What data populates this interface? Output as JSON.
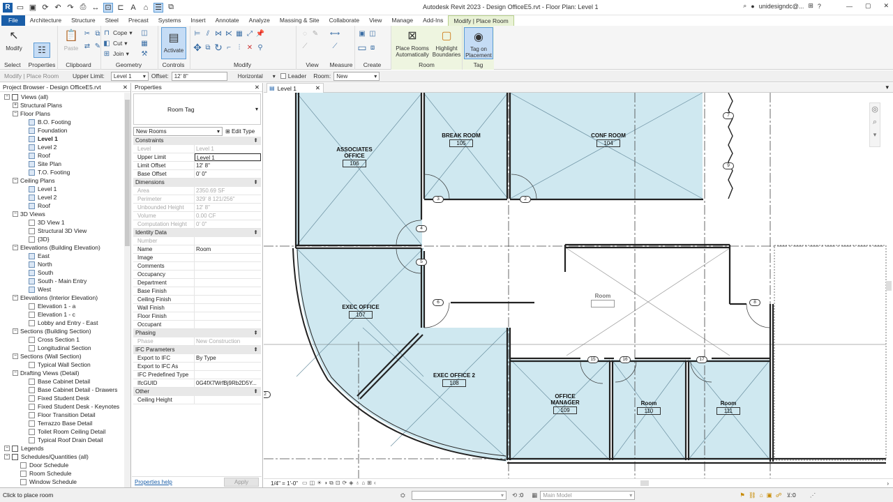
{
  "titlebar": {
    "title": "Autodesk Revit 2023 - Design OfficeE5.rvt - Floor Plan: Level 1",
    "user": "unidesigndc@...",
    "icons": [
      "binoculars-icon",
      "user-icon",
      "cart-icon",
      "help-icon"
    ]
  },
  "tabs": [
    "File",
    "Architecture",
    "Structure",
    "Steel",
    "Precast",
    "Systems",
    "Insert",
    "Annotate",
    "Analyze",
    "Massing & Site",
    "Collaborate",
    "View",
    "Manage",
    "Add-Ins",
    "Modify | Place Room"
  ],
  "ribbon": {
    "modify": "Modify",
    "select": "Select",
    "properties": "Properties",
    "paste": "Paste",
    "clipboard": "Clipboard",
    "cope": "Cope",
    "cut": "Cut",
    "join": "Join",
    "geometry": "Geometry",
    "activate": "Activate",
    "controls": "Controls",
    "modify_panel": "Modify",
    "view": "View",
    "measure": "Measure",
    "create": "Create",
    "place_rooms": "Place Rooms Automatically",
    "highlight": "Highlight Boundaries",
    "room_panel": "Room",
    "tag_on": "Tag on Placement",
    "tag_panel": "Tag"
  },
  "options": {
    "context": "Modify | Place Room",
    "upper_limit_label": "Upper Limit:",
    "upper_limit": "Level 1",
    "offset_label": "Offset:",
    "offset": "12'  8\"",
    "orientation": "Horizontal",
    "leader": "Leader",
    "room_label": "Room:",
    "room": "New"
  },
  "browser": {
    "title": "Project Browser - Design OfficeE5.rvt",
    "items": [
      {
        "t": "Views (all)",
        "d": 0,
        "e": "-",
        "i": "folder"
      },
      {
        "t": "Structural Plans",
        "d": 1,
        "e": "+"
      },
      {
        "t": "Floor Plans",
        "d": 1,
        "e": "-"
      },
      {
        "t": "B.O. Footing",
        "d": 2,
        "i": "v"
      },
      {
        "t": "Foundation",
        "d": 2,
        "i": "v"
      },
      {
        "t": "Level 1",
        "d": 2,
        "i": "v",
        "b": true
      },
      {
        "t": "Level 2",
        "d": 2,
        "i": "v"
      },
      {
        "t": "Roof",
        "d": 2,
        "i": "v"
      },
      {
        "t": "Site Plan",
        "d": 2,
        "i": "v"
      },
      {
        "t": "T.O. Footing",
        "d": 2,
        "i": "v"
      },
      {
        "t": "Ceiling Plans",
        "d": 1,
        "e": "-"
      },
      {
        "t": "Level 1",
        "d": 2,
        "i": "v"
      },
      {
        "t": "Level 2",
        "d": 2,
        "i": "v"
      },
      {
        "t": "Roof",
        "d": 2,
        "i": "v"
      },
      {
        "t": "3D Views",
        "d": 1,
        "e": "-"
      },
      {
        "t": "3D View 1",
        "d": 2,
        "i": "w"
      },
      {
        "t": "Structural 3D View",
        "d": 2,
        "i": "w"
      },
      {
        "t": "{3D}",
        "d": 2,
        "i": "w"
      },
      {
        "t": "Elevations (Building Elevation)",
        "d": 1,
        "e": "-"
      },
      {
        "t": "East",
        "d": 2,
        "i": "v"
      },
      {
        "t": "North",
        "d": 2,
        "i": "v"
      },
      {
        "t": "South",
        "d": 2,
        "i": "v"
      },
      {
        "t": "South - Main Entry",
        "d": 2,
        "i": "v"
      },
      {
        "t": "West",
        "d": 2,
        "i": "v"
      },
      {
        "t": "Elevations (Interior Elevation)",
        "d": 1,
        "e": "-"
      },
      {
        "t": "Elevation 1 - a",
        "d": 2,
        "i": "w"
      },
      {
        "t": "Elevation 1 - c",
        "d": 2,
        "i": "w"
      },
      {
        "t": "Lobby and Entry - East",
        "d": 2,
        "i": "w"
      },
      {
        "t": "Sections (Building Section)",
        "d": 1,
        "e": "-"
      },
      {
        "t": "Cross Section 1",
        "d": 2,
        "i": "w"
      },
      {
        "t": "Longitudinal Section",
        "d": 2,
        "i": "w"
      },
      {
        "t": "Sections (Wall Section)",
        "d": 1,
        "e": "-"
      },
      {
        "t": "Typical Wall Section",
        "d": 2,
        "i": "w"
      },
      {
        "t": "Drafting Views (Detail)",
        "d": 1,
        "e": "-"
      },
      {
        "t": "Base Cabinet Detail",
        "d": 2,
        "i": "w"
      },
      {
        "t": "Base Cabinet Detail - Drawers",
        "d": 2,
        "i": "w"
      },
      {
        "t": "Fixed Student Desk",
        "d": 2,
        "i": "w"
      },
      {
        "t": "Fixed Student Desk - Keynotes",
        "d": 2,
        "i": "w"
      },
      {
        "t": "Floor Transition Detail",
        "d": 2,
        "i": "w"
      },
      {
        "t": "Terrazzo Base Detail",
        "d": 2,
        "i": "w"
      },
      {
        "t": "Toilet Room Ceiling Detail",
        "d": 2,
        "i": "w"
      },
      {
        "t": "Typical Roof Drain Detail",
        "d": 2,
        "i": "w"
      },
      {
        "t": "Legends",
        "d": 0,
        "e": "-",
        "i": "folder"
      },
      {
        "t": "Schedules/Quantities (all)",
        "d": 0,
        "e": "-",
        "i": "folder"
      },
      {
        "t": "Door Schedule",
        "d": 1,
        "i": "s"
      },
      {
        "t": "Room Schedule",
        "d": 1,
        "i": "s"
      },
      {
        "t": "Window Schedule",
        "d": 1,
        "i": "s"
      }
    ]
  },
  "props": {
    "title": "Properties",
    "type_name": "Room Tag",
    "filter": "New Rooms",
    "edit_type": "Edit Type",
    "help": "Properties help",
    "apply": "Apply",
    "groups": [
      {
        "name": "Constraints",
        "rows": [
          [
            "Level",
            "Level 1",
            1
          ],
          [
            "Upper Limit",
            "Level 1",
            0
          ],
          [
            "Limit Offset",
            "12'  8\"",
            0
          ],
          [
            "Base Offset",
            "0'  0\"",
            0
          ]
        ]
      },
      {
        "name": "Dimensions",
        "rows": [
          [
            "Area",
            "2350.69 SF",
            1
          ],
          [
            "Perimeter",
            "329'  8 121/256\"",
            1
          ],
          [
            "Unbounded Height",
            "12'  8\"",
            1
          ],
          [
            "Volume",
            "0.00 CF",
            1
          ],
          [
            "Computation Height",
            "0'  0\"",
            1
          ]
        ]
      },
      {
        "name": "Identity Data",
        "rows": [
          [
            "Number",
            "",
            1
          ],
          [
            "Name",
            "Room",
            0
          ],
          [
            "Image",
            "",
            0
          ],
          [
            "Comments",
            "",
            0
          ],
          [
            "Occupancy",
            "",
            0
          ],
          [
            "Department",
            "",
            0
          ],
          [
            "Base Finish",
            "",
            0
          ],
          [
            "Ceiling Finish",
            "",
            0
          ],
          [
            "Wall Finish",
            "",
            0
          ],
          [
            "Floor Finish",
            "",
            0
          ],
          [
            "Occupant",
            "",
            0
          ]
        ]
      },
      {
        "name": "Phasing",
        "rows": [
          [
            "Phase",
            "New Construction",
            1
          ]
        ]
      },
      {
        "name": "IFC Parameters",
        "rows": [
          [
            "Export to IFC",
            "By Type",
            0
          ],
          [
            "Export to IFC As",
            "",
            0
          ],
          [
            "IFC Predefined Type",
            "",
            0
          ],
          [
            "IfcGUID",
            "0G4fX7WrfBj9Rb2D5Y...",
            0
          ]
        ]
      },
      {
        "name": "Other",
        "rows": [
          [
            "Ceiling Height",
            "",
            0
          ]
        ]
      }
    ]
  },
  "view": {
    "tab": "Level 1",
    "scale": "1/4\" = 1'-0\"",
    "rooms": [
      {
        "name": "ASSOCIATES",
        "name2": "OFFICE",
        "num": "106"
      },
      {
        "name": "BREAK ROOM",
        "num": "105"
      },
      {
        "name": "CONF ROOM",
        "num": "104"
      },
      {
        "name": "EXEC OFFICE",
        "num": "107"
      },
      {
        "name": "EXEC OFFICE 2",
        "num": "108"
      },
      {
        "name": "OFFICE",
        "name2": "MANAGER",
        "num": "109"
      },
      {
        "name": "Room",
        "num": "110"
      },
      {
        "name": "Room",
        "num": "111"
      },
      {
        "name": "Room",
        "num": ""
      }
    ],
    "door_tags": [
      "3",
      "2",
      "4",
      "5",
      "6",
      "8",
      "7",
      "9",
      "15",
      "16",
      "17",
      "2"
    ]
  },
  "status": {
    "text": "Click to place room",
    "coords": ":0",
    "model": "Main Model",
    "filter_count": ":0"
  }
}
